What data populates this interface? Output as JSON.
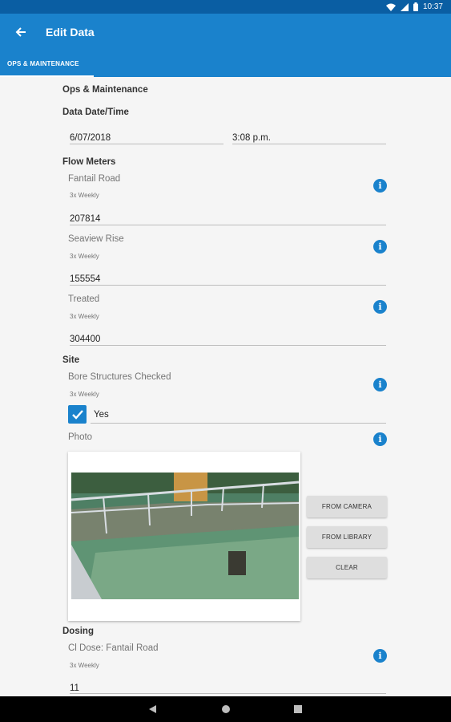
{
  "status_bar": {
    "time": "10:37",
    "icons": [
      "wifi-icon",
      "signal-icon",
      "battery-icon"
    ]
  },
  "app_bar": {
    "title": "Edit Data",
    "back_icon": "arrow-back-icon"
  },
  "tabs": [
    {
      "label": "OPS & MAINTENANCE",
      "selected": true
    }
  ],
  "form": {
    "heading": "Ops & Maintenance",
    "datetime": {
      "label": "Data Date/Time",
      "date": "6/07/2018",
      "time": "3:08 p.m."
    },
    "flow_meters": {
      "title": "Flow Meters",
      "items": [
        {
          "label": "Fantail Road",
          "frequency": "3x Weekly",
          "value": "207814"
        },
        {
          "label": "Seaview Rise",
          "frequency": "3x Weekly",
          "value": "155554"
        },
        {
          "label": "Treated",
          "frequency": "3x Weekly",
          "value": "304400"
        }
      ]
    },
    "site": {
      "title": "Site",
      "bore": {
        "label": "Bore Structures Checked",
        "frequency": "3x Weekly",
        "checked": true,
        "check_label": "Yes"
      },
      "photo": {
        "label": "Photo",
        "image_icon": "water-tank-photo",
        "buttons": {
          "camera": "FROM CAMERA",
          "library": "FROM LIBRARY",
          "clear": "CLEAR"
        }
      }
    },
    "dosing": {
      "title": "Dosing",
      "items": [
        {
          "label": "Cl Dose: Fantail Road",
          "frequency": "3x Weekly",
          "value": "11"
        }
      ]
    }
  },
  "nav_bar": {
    "icons": [
      "back-triangle-icon",
      "home-circle-icon",
      "recents-square-icon"
    ]
  },
  "colors": {
    "primary": "#1a82cc",
    "status_bar": "#0a5ea3",
    "background": "#f5f5f5"
  }
}
